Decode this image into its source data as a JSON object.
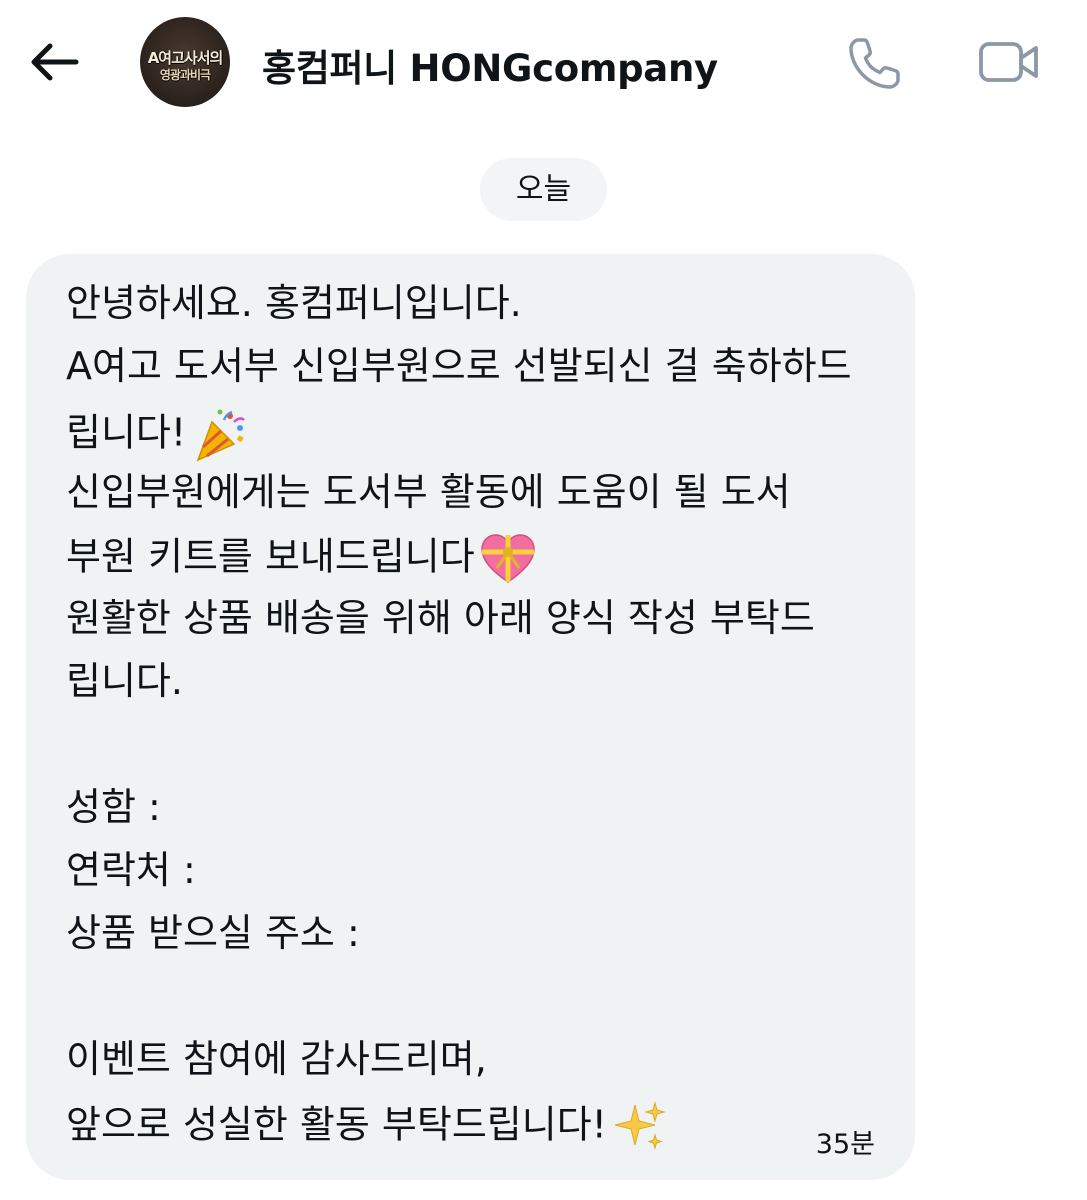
{
  "header": {
    "back_icon": "arrow-left-icon",
    "avatar": {
      "line1": "A여고사서의",
      "line2": "영광과비극"
    },
    "title": "홍컴퍼니 HONGcompany",
    "phone_icon": "phone-icon",
    "video_icon": "video-camera-icon"
  },
  "date_divider": "오늘",
  "message": {
    "lines": [
      "안녕하세요. 홍컴퍼니입니다.",
      "A여고 도서부 신입부원으로 선발되신 걸 축하하드",
      "립니다!",
      "신입부원에게는 도서부 활동에 도움이 될 도서",
      "부원 키트를 보내드립니다",
      "원활한 상품 배송을 위해 아래 양식 작성 부탁드",
      "립니다.",
      "",
      "성함 :",
      "연락처 :",
      "상품 받으실 주소 :",
      "",
      "이벤트 참여에 감사드리며,",
      "앞으로 성실한 활동 부탁드립니다!"
    ],
    "emojis": {
      "line3": "party-popper-icon",
      "line5": "heart-with-ribbon-icon",
      "line14": "sparkles-icon"
    },
    "timestamp": "35분",
    "colors": {
      "bubble_bg": "#eff3f4",
      "text": "#0f1419"
    }
  }
}
